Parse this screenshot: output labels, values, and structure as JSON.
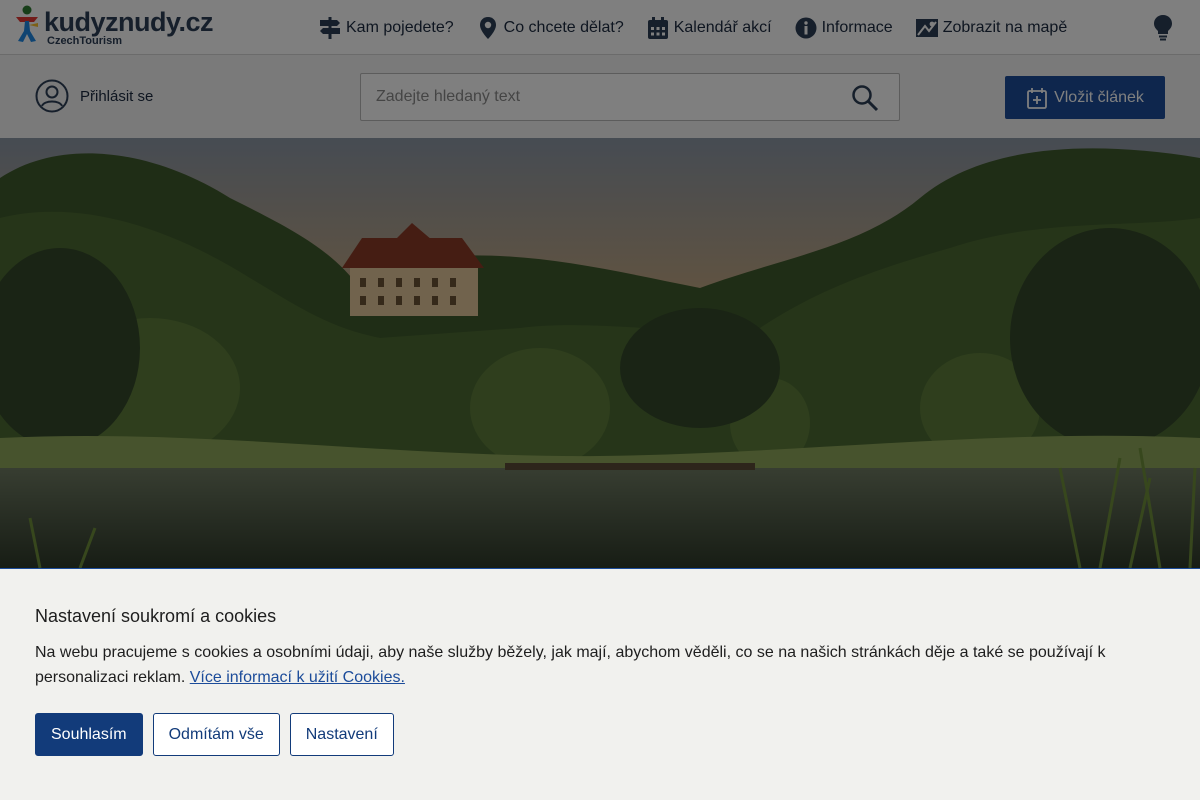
{
  "brand": {
    "name": "kudyznudy.cz",
    "subtitle": "CzechTourism"
  },
  "nav": [
    {
      "label": "Kam pojedete?",
      "icon": "signpost-icon"
    },
    {
      "label": "Co chcete dělat?",
      "icon": "map-pin-icon"
    },
    {
      "label": "Kalendář akcí",
      "icon": "calendar-icon"
    },
    {
      "label": "Informace",
      "icon": "info-icon"
    },
    {
      "label": "Zobrazit na mapě",
      "icon": "map-icon"
    }
  ],
  "header": {
    "login_label": "Přihlásit se",
    "search_placeholder": "Zadejte hledaný text",
    "insert_label": "Vložit článek"
  },
  "cookie": {
    "title": "Nastavení soukromí a cookies",
    "text": "Na webu pracujeme s cookies a osobními údaji, aby naše služby běžely, jak mají, abychom věděli, co se na našich stránkách děje a také se používají k personalizaci reklam.",
    "link": "Více informací k užití Cookies.",
    "accept": "Souhlasím",
    "reject": "Odmítám vše",
    "settings": "Nastavení"
  },
  "colors": {
    "primary": "#123b7a",
    "accent_blue": "#1c4c9a",
    "text": "#1e1e1e",
    "banner_bg": "#f1f1ee"
  }
}
